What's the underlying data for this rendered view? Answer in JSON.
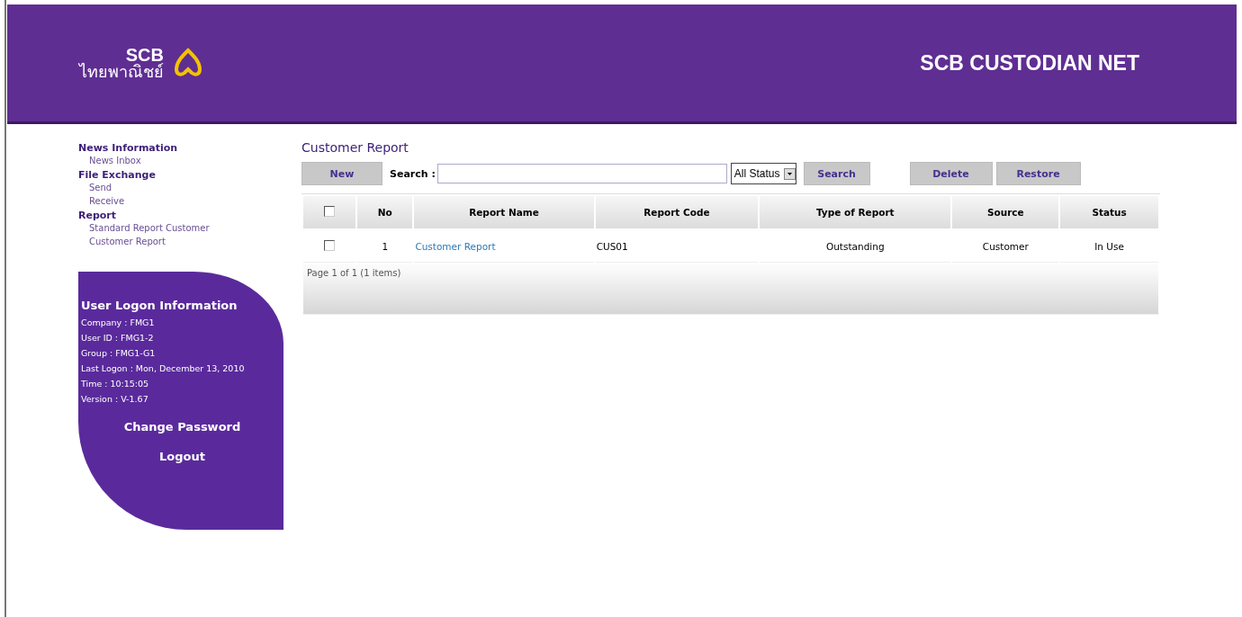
{
  "header": {
    "logo_top": "SCB",
    "logo_bottom": "ไทยพาณิชย์",
    "title": "SCB CUSTODIAN NET"
  },
  "nav": [
    {
      "label": "News Information",
      "children": [
        {
          "label": "News Inbox"
        }
      ]
    },
    {
      "label": "File Exchange",
      "children": [
        {
          "label": "Send"
        },
        {
          "label": "Receive"
        }
      ]
    },
    {
      "label": "Report",
      "children": [
        {
          "label": "Standard Report Customer"
        },
        {
          "label": "Customer Report"
        }
      ]
    }
  ],
  "logon": {
    "title": "User Logon Information",
    "lines": [
      "Company : FMG1",
      "User ID : FMG1-2",
      "Group : FMG1-G1",
      "Last Logon : Mon, December 13, 2010",
      "Time : 10:15:05",
      "Version : V-1.67"
    ],
    "links": [
      "Change Password",
      "Logout"
    ]
  },
  "page_title": "Customer Report",
  "toolbar": {
    "new": "New",
    "search_label": "Search :",
    "status_select": "All Status",
    "search": "Search",
    "delete": "Delete",
    "restore": "Restore"
  },
  "table": {
    "columns": [
      "No",
      "Report Name",
      "Report Code",
      "Type of Report",
      "Source",
      "Status"
    ],
    "header_checked": false,
    "rows": [
      {
        "checked": false,
        "no": "1",
        "name": "Customer Report",
        "code": "CUS01",
        "type": "Outstanding",
        "source": "Customer",
        "status": "In Use"
      }
    ],
    "pager": "Page 1 of 1 (1 items)"
  }
}
